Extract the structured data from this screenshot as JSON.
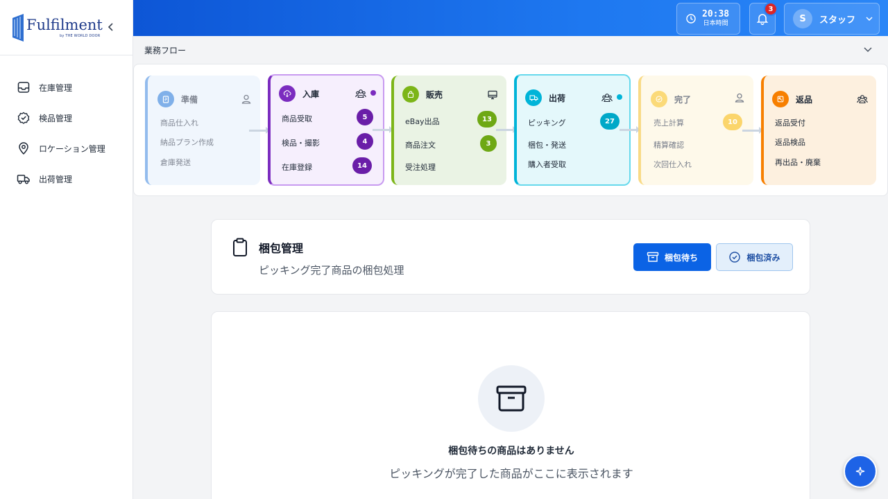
{
  "sidebar": {
    "logo_text": "Fulfilment",
    "logo_sub": "by THE WORLD DOOR",
    "items": [
      {
        "label": "在庫管理",
        "icon": "inbox-icon"
      },
      {
        "label": "検品管理",
        "icon": "check-circle-icon"
      },
      {
        "label": "ロケーション管理",
        "icon": "map-pin-icon"
      },
      {
        "label": "出荷管理",
        "icon": "truck-icon"
      }
    ]
  },
  "header": {
    "time": "20:38",
    "timezone": "日本時間",
    "notifications": "3",
    "user_initial": "S",
    "user_name": "スタッフ"
  },
  "flow": {
    "title": "業務フロー",
    "stages": [
      {
        "name": "準備",
        "color": "#4a90e2",
        "items": [
          "商品仕入れ",
          "納品プラン作成",
          "倉庫発送"
        ],
        "counts": []
      },
      {
        "name": "入庫",
        "color": "#7b2cbf",
        "items": [
          "商品受取",
          "検品・撮影",
          "在庫登録"
        ],
        "counts": [
          "5",
          "4",
          "14"
        ]
      },
      {
        "name": "販売",
        "color": "#7cb518",
        "items": [
          "eBay出品",
          "商品注文",
          "受注処理"
        ],
        "counts": [
          "13",
          "3"
        ]
      },
      {
        "name": "出荷",
        "color": "#00b4d8",
        "items": [
          "ピッキング",
          "梱包・発送",
          "購入者受取"
        ],
        "counts": [
          "27"
        ]
      },
      {
        "name": "完了",
        "color": "#f9c74f",
        "items": [
          "売上計算",
          "精算確認",
          "次回仕入れ"
        ],
        "counts": [
          "10"
        ]
      },
      {
        "name": "返品",
        "color": "#f77f00",
        "items": [
          "返品受付",
          "返品検品",
          "再出品・廃棄"
        ],
        "counts": []
      }
    ]
  },
  "packing": {
    "title": "梱包管理",
    "subtitle": "ピッキング完了商品の梱包処理",
    "btn_waiting": "梱包待ち",
    "btn_done": "梱包済み"
  },
  "empty": {
    "title": "梱包待ちの商品はありません",
    "subtitle": "ピッキングが完了した商品がここに表示されます"
  }
}
